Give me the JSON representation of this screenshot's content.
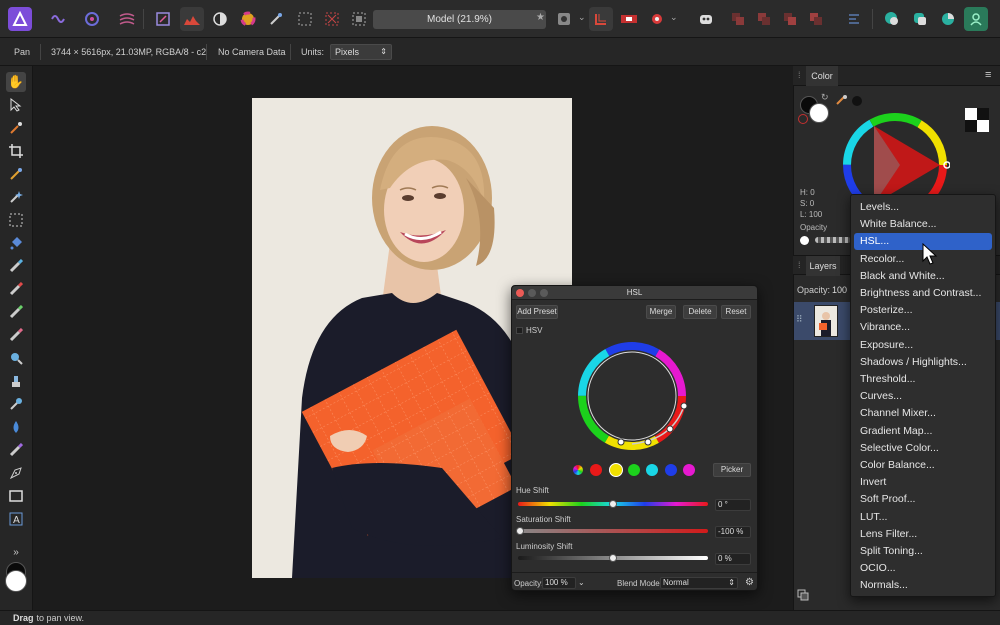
{
  "toolbar": {
    "document_title": "Model (21.9%)"
  },
  "context_bar": {
    "tool_name": "Pan",
    "image_info": "3744 × 5616px, 21.03MP, RGBA/8 - c2",
    "camera_info": "No Camera Data",
    "units_label": "Units:",
    "units_value": "Pixels"
  },
  "color_panel": {
    "tab_label": "Color",
    "h_label": "H: 0",
    "s_label": "S: 0",
    "l_label": "L: 100",
    "opacity_label": "Opacity"
  },
  "layers_panel": {
    "tab_label": "Layers",
    "opacity_label": "Opacity:",
    "opacity_value": "100"
  },
  "hsl_dialog": {
    "title": "HSL",
    "add_preset_label": "Add Preset",
    "merge_label": "Merge",
    "delete_label": "Delete",
    "reset_label": "Reset",
    "hsv_label": "HSV",
    "picker_label": "Picker",
    "hue_shift_label": "Hue Shift",
    "hue_shift_value": "0 °",
    "saturation_shift_label": "Saturation Shift",
    "saturation_shift_value": "-100 %",
    "luminosity_shift_label": "Luminosity Shift",
    "luminosity_shift_value": "0 %",
    "opacity_label": "Opacity:",
    "opacity_value": "100 %",
    "blend_mode_label": "Blend Mode:",
    "blend_mode_value": "Normal",
    "swatch_colors": [
      "#e81919",
      "#f0e000",
      "#1cd11c",
      "#19d6e6",
      "#1f3de8",
      "#e619d0"
    ]
  },
  "adjustment_menu": {
    "items": [
      "Levels...",
      "White Balance...",
      "HSL...",
      "Recolor...",
      "Black and White...",
      "Brightness and Contrast...",
      "Posterize...",
      "Vibrance...",
      "Exposure...",
      "Shadows / Highlights...",
      "Threshold...",
      "Curves...",
      "Channel Mixer...",
      "Gradient Map...",
      "Selective Color...",
      "Color Balance...",
      "Invert",
      "Soft Proof...",
      "LUT...",
      "Lens Filter...",
      "Split Toning...",
      "OCIO...",
      "Normals..."
    ],
    "selected": "HSL..."
  },
  "status_bar": {
    "bold_text": "Drag",
    "rest_text": " to pan view."
  },
  "colors": {
    "accent": "#2f62c9",
    "photo_background": "#ece8e0",
    "book_orange": "#f4622c",
    "sweater": "#1b1c2a"
  }
}
